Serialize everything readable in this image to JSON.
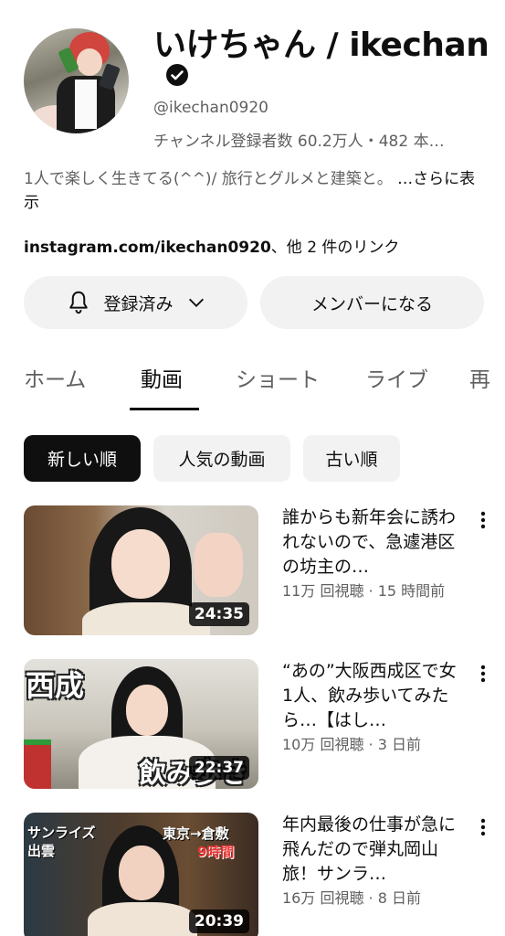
{
  "channel": {
    "name": "いけちゃん / ikechan",
    "handle": "@ikechan0920",
    "stats": "チャンネル登録者数 60.2万人・482 本…",
    "description": "1人で楽しく生きてる(^^)/ 旅行とグルメと建築と。",
    "description_more": " …さらに表示",
    "link_url": "instagram.com/ikechan0920",
    "link_more": "、他 2 件のリンク"
  },
  "buttons": {
    "subscribed": "登録済み",
    "membership": "メンバーになる"
  },
  "tabs": [
    {
      "label": "ホーム"
    },
    {
      "label": "動画"
    },
    {
      "label": "ショート"
    },
    {
      "label": "ライブ"
    },
    {
      "label": "再"
    }
  ],
  "active_tab": "動画",
  "chips": [
    {
      "label": "新しい順"
    },
    {
      "label": "人気の動画"
    },
    {
      "label": "古い順"
    }
  ],
  "videos": [
    {
      "title": "誰からも新年会に誘われないので、急遽港区の坊主の…",
      "meta": "11万 回視聴 · 15 時間前",
      "duration": "24:35"
    },
    {
      "title": "“あの”大阪西成区で女1人、飲み歩いてみたら…【はし…",
      "meta": "10万 回視聴 · 3 日前",
      "duration": "22:37",
      "thumb_text_top": "西成",
      "thumb_text_bottom": "飲み歩き"
    },
    {
      "title": "年内最後の仕事が急に飛んだので弾丸岡山旅！サンラ…",
      "meta": "16万 回視聴 · 8 日前",
      "duration": "20:39",
      "thumb_text_left": "サンライズ\n出雲",
      "thumb_text_right": "東京→倉敷",
      "thumb_text_right2": "9時間"
    }
  ],
  "colors": {
    "text_primary": "#0f0f0f",
    "text_secondary": "#606060",
    "chip_bg": "#f2f2f2",
    "chip_active_bg": "#0f0f0f"
  }
}
